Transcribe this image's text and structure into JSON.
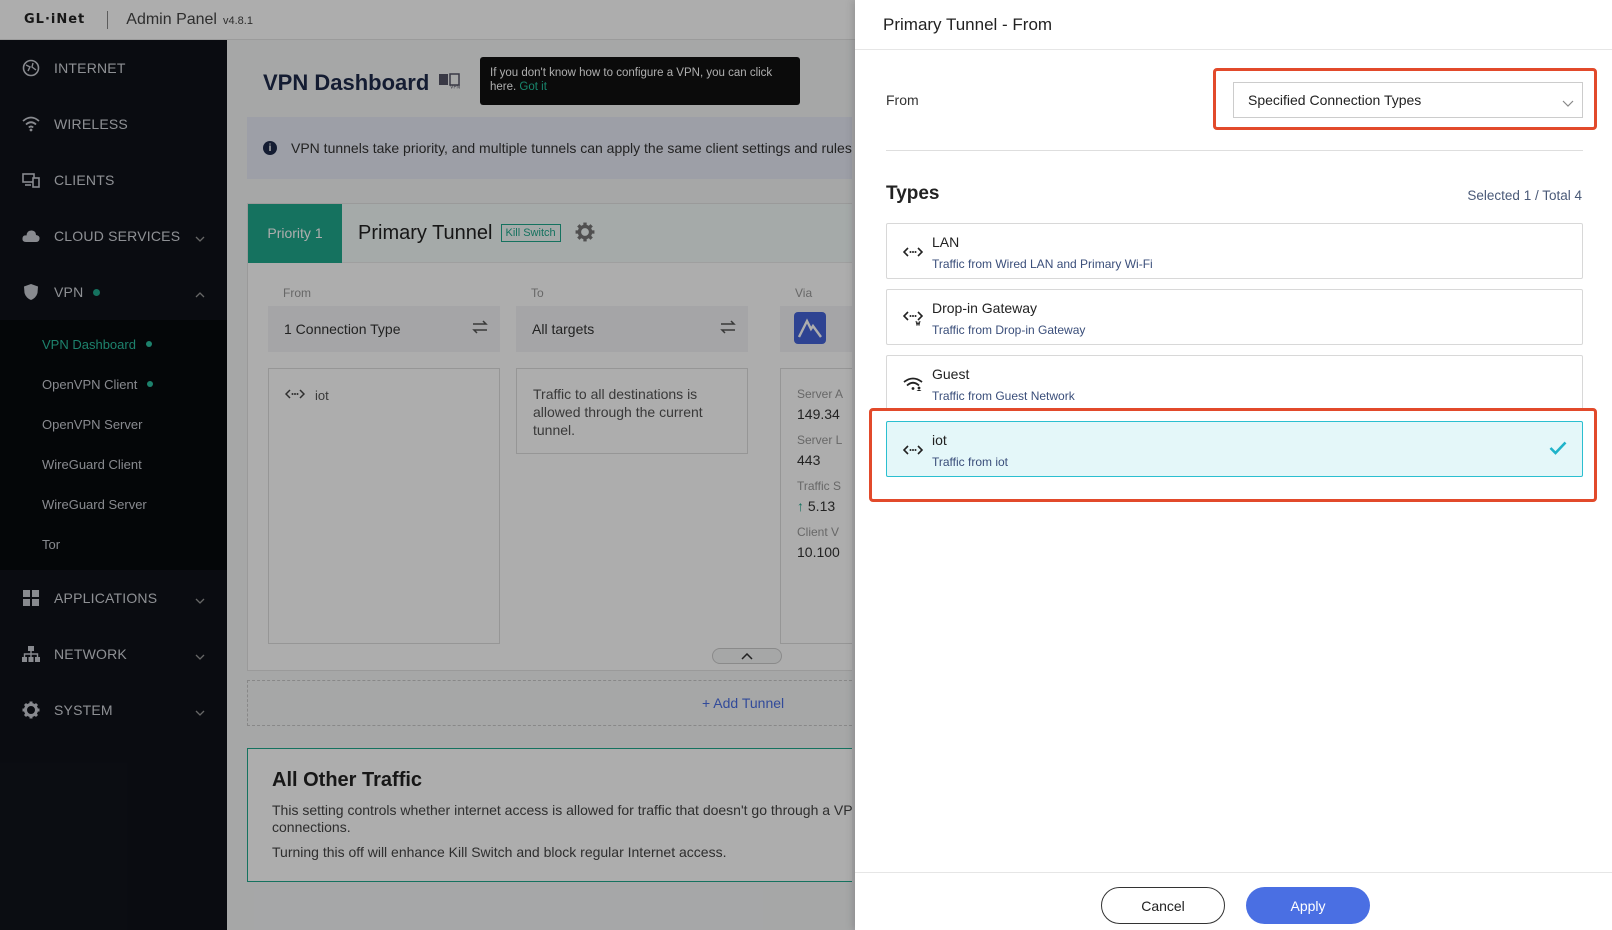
{
  "header": {
    "logo": "GL·iNet",
    "title": "Admin Panel",
    "version": "v4.8.1"
  },
  "sidebar": {
    "items": [
      {
        "label": "INTERNET",
        "icon": "globe-icon"
      },
      {
        "label": "WIRELESS",
        "icon": "wifi-icon"
      },
      {
        "label": "CLIENTS",
        "icon": "devices-icon"
      },
      {
        "label": "CLOUD SERVICES",
        "icon": "cloud-icon"
      },
      {
        "label": "VPN",
        "icon": "shield-icon"
      },
      {
        "label": "APPLICATIONS",
        "icon": "grid-icon"
      },
      {
        "label": "NETWORK",
        "icon": "network-icon"
      },
      {
        "label": "SYSTEM",
        "icon": "gear-icon"
      }
    ],
    "vpn_sub": [
      {
        "label": "VPN Dashboard"
      },
      {
        "label": "OpenVPN Client"
      },
      {
        "label": "OpenVPN Server"
      },
      {
        "label": "WireGuard Client"
      },
      {
        "label": "WireGuard Server"
      },
      {
        "label": "Tor"
      }
    ]
  },
  "main": {
    "title": "VPN Dashboard",
    "tooltip_text": "If you don't know how to configure a VPN, you can click here.",
    "tooltip_link": "Got it",
    "banner": "VPN tunnels take priority, and multiple tunnels can apply the same client settings and rules",
    "tunnel": {
      "priority": "Priority 1",
      "name": "Primary Tunnel",
      "kill_switch": "Kill Switch",
      "from_label": "From",
      "from_value": "1 Connection Type",
      "to_label": "To",
      "to_value": "All targets",
      "via_label": "Via",
      "from_item": "iot",
      "to_desc": "Traffic to all destinations is allowed through the current tunnel.",
      "via_lines": [
        "Server A",
        "149.34",
        "Server L",
        "443",
        "Traffic S",
        "5.13",
        "Client V",
        "10.100"
      ]
    },
    "add_tunnel": "+ Add Tunnel",
    "other": {
      "title": "All Other Traffic",
      "line1": "This setting controls whether internet access is allowed for traffic that doesn't go through a VP",
      "line2": "connections.",
      "line3": "Turning this off will enhance Kill Switch and block regular Internet access."
    }
  },
  "drawer": {
    "title": "Primary Tunnel - From",
    "from_label": "From",
    "from_value": "Specified Connection Types",
    "types_title": "Types",
    "types_count": "Selected 1 / Total 4",
    "types": [
      {
        "name": "LAN",
        "desc": "Traffic from Wired LAN and Primary Wi-Fi",
        "icon": "lan-icon",
        "selected": false
      },
      {
        "name": "Drop-in Gateway",
        "desc": "Traffic from Drop-in Gateway",
        "icon": "gateway-icon",
        "selected": false
      },
      {
        "name": "Guest",
        "desc": "Traffic from Guest Network",
        "icon": "guest-wifi-icon",
        "selected": false
      },
      {
        "name": "iot",
        "desc": "Traffic from iot",
        "icon": "iot-icon",
        "selected": true
      }
    ],
    "cancel": "Cancel",
    "apply": "Apply"
  },
  "colors": {
    "accent": "#1fa88c",
    "primary_button": "#4a6fe3",
    "highlight": "#e24a2b",
    "sidebar_bg": "#10131a"
  }
}
